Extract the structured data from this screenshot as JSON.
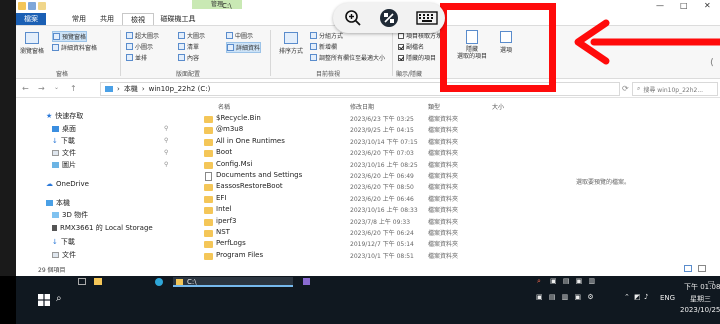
{
  "window": {
    "context_tab_label": "管理",
    "path_title": "C:\\",
    "controls": {
      "minimize": "—",
      "maximize": "□",
      "close": "✕"
    }
  },
  "tabs": [
    {
      "label": "檔案"
    },
    {
      "label": "常用"
    },
    {
      "label": "共用"
    },
    {
      "label": "檢視"
    },
    {
      "label": "磁碟機工具"
    }
  ],
  "ribbon": {
    "pane": {
      "nav_pane": "瀏覽窗格",
      "preview_pane": "預覽窗格",
      "details_pane": "詳細資料窗格",
      "group": "窗格"
    },
    "layout": {
      "extra_large": "超大圖示",
      "large": "大圖示",
      "medium": "中圖示",
      "small": "小圖示",
      "list": "清單",
      "details": "詳細資料",
      "tiles": "並排",
      "content": "內容",
      "group": "版面配置"
    },
    "view": {
      "sort": "排序方式",
      "group_by": "分組方式",
      "add_column": "新增欄",
      "fit_columns": "調整所有欄位至最適大小",
      "group": "目前檢視"
    },
    "show_hide": {
      "item_checkboxes": "項目核取方塊",
      "file_ext": "副檔名",
      "hidden_items": "隱藏的項目",
      "hide_selected": "隱藏\n選取的項目",
      "options": "選項",
      "group": "顯示/隱藏"
    }
  },
  "address": {
    "crumb_pc": "本機",
    "crumb_drive": "win10p_22h2 (C:)",
    "search_placeholder": "搜尋 win10p_22h2..."
  },
  "nav": {
    "quick_access": "快速存取",
    "desktop": "桌面",
    "downloads": "下載",
    "documents": "文件",
    "pictures": "圖片",
    "onedrive": "OneDrive",
    "this_pc": "本機",
    "objects3d": "3D 物件",
    "rmx": "RMX3661 的 Local Storage",
    "pc_downloads": "下載",
    "pc_documents": "文件"
  },
  "columns": {
    "name": "名稱",
    "date": "修改日期",
    "type": "類型",
    "size": "大小"
  },
  "files": [
    {
      "name": "$Recycle.Bin",
      "date": "2023/6/23 下午 03:25",
      "type": "檔案資料夾",
      "kind": "folder"
    },
    {
      "name": "@m3u8",
      "date": "2023/9/25 上午 04:15",
      "type": "檔案資料夾",
      "kind": "folder"
    },
    {
      "name": "All in One Runtimes",
      "date": "2023/10/14 下午 07:15",
      "type": "檔案資料夾",
      "kind": "folder"
    },
    {
      "name": "Boot",
      "date": "2023/6/20 下午 07:03",
      "type": "檔案資料夾",
      "kind": "folder"
    },
    {
      "name": "Config.Msi",
      "date": "2023/10/16 上午 08:25",
      "type": "檔案資料夾",
      "kind": "folder"
    },
    {
      "name": "Documents and Settings",
      "date": "2023/6/20 上午 06:49",
      "type": "檔案資料夾",
      "kind": "shortcut"
    },
    {
      "name": "EassosRestoreBoot",
      "date": "2023/6/20 下午 08:50",
      "type": "檔案資料夾",
      "kind": "folder"
    },
    {
      "name": "EFI",
      "date": "2023/6/20 上午 06:46",
      "type": "檔案資料夾",
      "kind": "folder"
    },
    {
      "name": "Intel",
      "date": "2023/10/16 上午 08:33",
      "type": "檔案資料夾",
      "kind": "folder"
    },
    {
      "name": "iperf3",
      "date": "2023/7/8 上午 09:33",
      "type": "檔案資料夾",
      "kind": "folder"
    },
    {
      "name": "NST",
      "date": "2023/6/20 下午 06:24",
      "type": "檔案資料夾",
      "kind": "folder"
    },
    {
      "name": "PerfLogs",
      "date": "2019/12/7 下午 05:14",
      "type": "檔案資料夾",
      "kind": "folder"
    },
    {
      "name": "Program Files",
      "date": "2023/10/1 下午 08:51",
      "type": "檔案資料夾",
      "kind": "folder"
    }
  ],
  "preview_message": "選取要預覽的檔案。",
  "status": {
    "count": "29 個項目"
  },
  "taskbar": {
    "active_title": "C:\\",
    "time": "下午 01:08",
    "weekday": "星期三",
    "date": "2023/10/25",
    "lang": "ENG"
  },
  "colors": {
    "accent": "#1a5fb4",
    "highlight": "#ff0b0b",
    "folder": "#f4c658"
  }
}
